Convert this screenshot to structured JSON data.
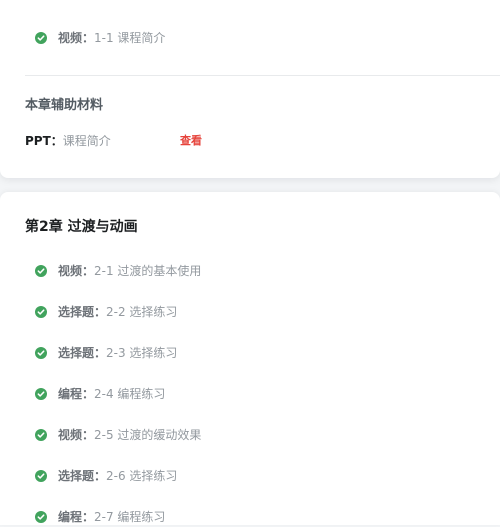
{
  "top_section": {
    "lesson": {
      "type": "视频：",
      "title": "1-1 课程简介"
    },
    "materials_title": "本章辅助材料",
    "material": {
      "label": "PPT：",
      "name": "课程简介",
      "action": "查看"
    }
  },
  "chapter": {
    "title": "第2章 过渡与动画",
    "lessons": [
      {
        "type": "视频：",
        "title": "2-1 过渡的基本使用"
      },
      {
        "type": "选择题：",
        "title": "2-2 选择练习"
      },
      {
        "type": "选择题：",
        "title": "2-3 选择练习"
      },
      {
        "type": "编程：",
        "title": "2-4 编程练习"
      },
      {
        "type": "视频：",
        "title": "2-5 过渡的缓动效果"
      },
      {
        "type": "选择题：",
        "title": "2-6 选择练习"
      },
      {
        "type": "编程：",
        "title": "2-7 编程练习"
      }
    ]
  },
  "colors": {
    "check": "#41a35d",
    "link": "#e6443c"
  },
  "icons": {
    "completed": "check-circle-icon"
  }
}
